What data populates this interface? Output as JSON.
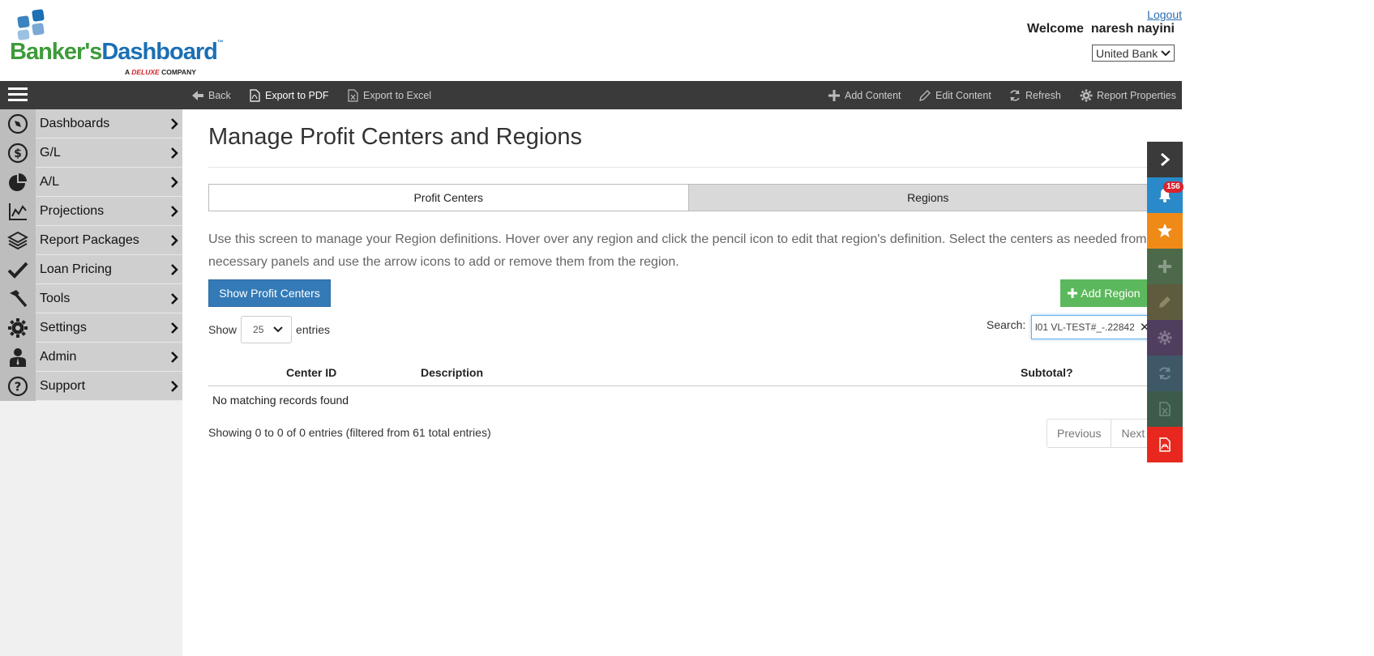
{
  "header": {
    "logo": {
      "word1": "Banker's",
      "word2": "Dashboard",
      "tm": "™",
      "sub_prefix": "A",
      "sub_brand": "DELUXE",
      "sub_suffix": "COMPANY"
    },
    "logout": "Logout",
    "welcome": "Welcome  naresh nayini",
    "bank": "United Bank"
  },
  "toolbar": {
    "back": "Back",
    "export_pdf": "Export to PDF",
    "export_excel": "Export to Excel",
    "add_content": "Add Content",
    "edit_content": "Edit Content",
    "refresh": "Refresh",
    "report_properties": "Report Properties"
  },
  "sidebar": {
    "items": [
      {
        "label": "Dashboards",
        "icon": "compass-icon"
      },
      {
        "label": "G/L",
        "icon": "dollar-icon"
      },
      {
        "label": "A/L",
        "icon": "pie-icon"
      },
      {
        "label": "Projections",
        "icon": "line-chart-icon"
      },
      {
        "label": "Report Packages",
        "icon": "layers-icon"
      },
      {
        "label": "Loan Pricing",
        "icon": "checkmark-icon"
      },
      {
        "label": "Tools",
        "icon": "hammer-icon"
      },
      {
        "label": "Settings",
        "icon": "gear-icon"
      },
      {
        "label": "Admin",
        "icon": "admin-icon"
      },
      {
        "label": "Support",
        "icon": "question-icon"
      }
    ]
  },
  "main": {
    "title": "Manage Profit Centers and Regions",
    "tabs": [
      "Profit Centers",
      "Regions"
    ],
    "description": "Use this screen to manage your Region definitions. Hover over any region and click the pencil icon to edit that region's definition. Select the centers as needed from the necessary panels and use the arrow icons to add or remove them from the region.",
    "show_profit_centers": "Show Profit Centers",
    "add_region": "Add Region",
    "show_label": "Show",
    "entries_value": "25",
    "entries_label": "entries",
    "search_label": "Search:",
    "search_value": "l01 VL-TEST#_-.22842",
    "columns": [
      "Center ID",
      "Description",
      "Subtotal?"
    ],
    "empty_message": "No matching records found",
    "info": "Showing 0 to 0 of 0 entries (filtered from 61 total entries)",
    "pagination": [
      "Previous",
      "Next"
    ]
  },
  "rail": {
    "notification_count": "156",
    "buttons": [
      {
        "name": "collapse-arrow-icon",
        "color": "#3a3a3a"
      },
      {
        "name": "bell-icon",
        "color": "#2a8ac9"
      },
      {
        "name": "star-icon",
        "color": "#f08a16"
      },
      {
        "name": "plus-icon",
        "color": "#4c6a4a"
      },
      {
        "name": "pencil-icon",
        "color": "#5e5b3e"
      },
      {
        "name": "gear-icon",
        "color": "#4f3e5e"
      },
      {
        "name": "refresh-icon",
        "color": "#3f5868"
      },
      {
        "name": "excel-icon",
        "color": "#3c5b4b"
      },
      {
        "name": "pdf-icon",
        "color": "#e8281e"
      }
    ]
  }
}
